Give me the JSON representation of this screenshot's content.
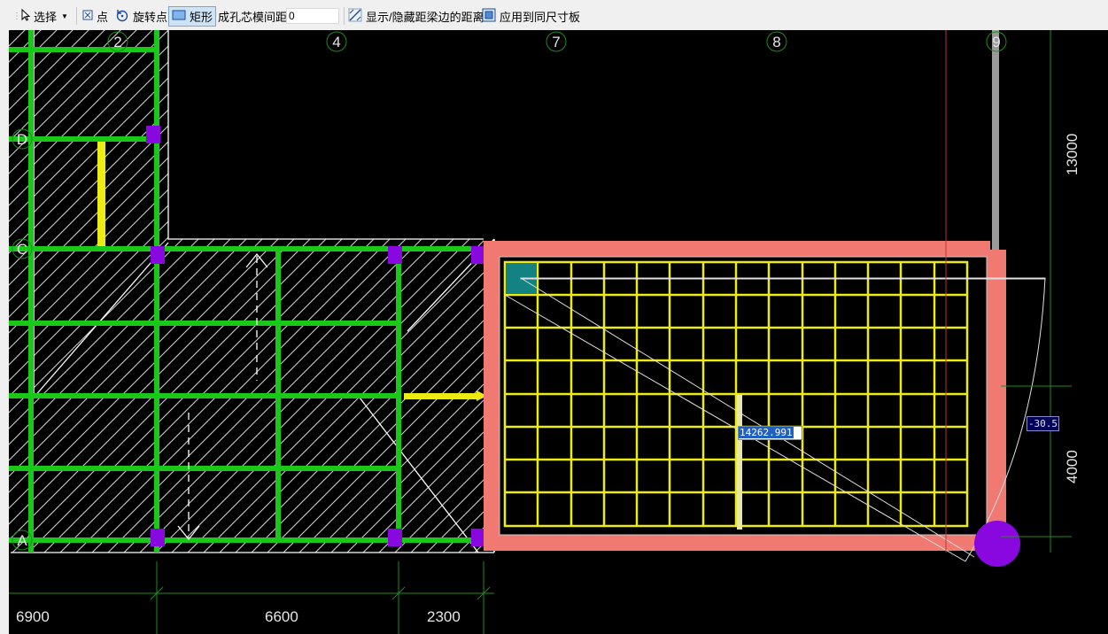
{
  "toolbar": {
    "select_label": "选择",
    "point_label": "点",
    "rotate_point_label": "旋转点",
    "rectangle_label": "矩形",
    "spacing_label": "成孔芯模间距",
    "spacing_value": "0",
    "toggle_distance_label": "显示/隐藏距梁边的距离",
    "apply_same_size_label": "应用到同尺寸板"
  },
  "axis_labels": {
    "a2": "2",
    "a4": "4",
    "a7": "7",
    "a8": "8",
    "a9": "9",
    "rD": "D",
    "rC": "C",
    "rA": "A"
  },
  "dimensions": {
    "d1": "6900",
    "d2": "6600",
    "d3": "2300",
    "v1": "13000",
    "v2": "4000"
  },
  "dynamic_input": {
    "length_value": "14262.991",
    "angle_value": "-30.5"
  },
  "colors": {
    "beam_green": "#19c819",
    "grid_yellow": "#ecec14",
    "slab_border": "#f07a72",
    "column_purple": "#8a08e0",
    "cursor_cell": "#128282"
  }
}
